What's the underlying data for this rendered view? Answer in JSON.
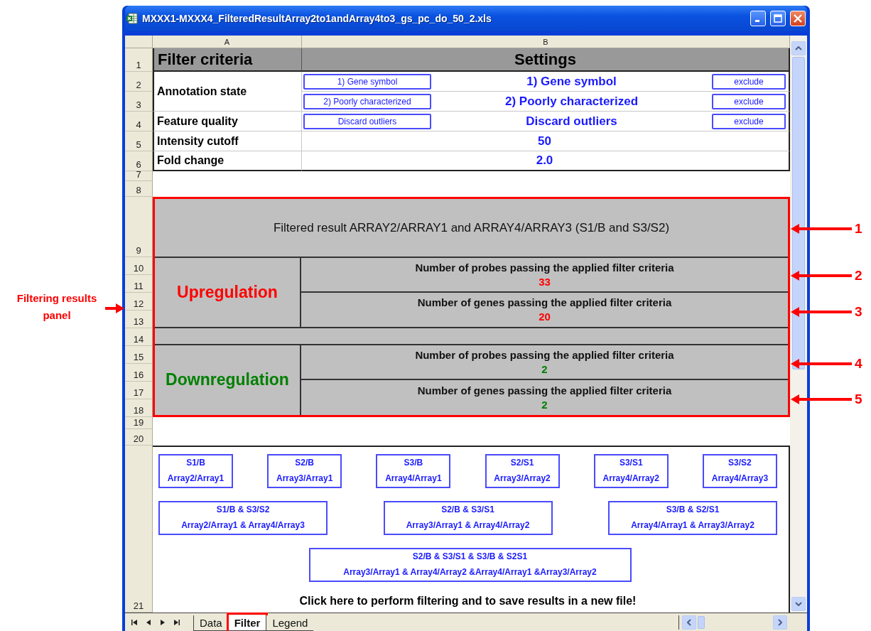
{
  "window": {
    "title": "MXXX1-MXXX4_FilteredResultArray2to1andArray4to3_gs_pc_do_50_2.xls"
  },
  "column_headers": [
    "A",
    "B"
  ],
  "row_numbers": [
    "1",
    "2",
    "3",
    "4",
    "5",
    "6",
    "7",
    "8",
    "9",
    "10",
    "11",
    "12",
    "13",
    "14",
    "15",
    "16",
    "17",
    "18",
    "19",
    "20",
    "21"
  ],
  "criteria": {
    "header": [
      "Filter criteria",
      "Settings"
    ],
    "rows": [
      {
        "label": "Annotation state",
        "settings": [
          {
            "button": "1) Gene symbol",
            "value": "1) Gene symbol",
            "action": "exclude"
          },
          {
            "button": "2) Poorly characterized",
            "value": "2) Poorly characterized",
            "action": "exclude"
          }
        ]
      },
      {
        "label": "Feature quality",
        "settings": [
          {
            "button": "Discard outliers",
            "value": "Discard outliers",
            "action": "exclude"
          }
        ]
      },
      {
        "label": "Intensity cutoff",
        "settings": [
          {
            "value": "50"
          }
        ]
      },
      {
        "label": "Fold change",
        "settings": [
          {
            "value": "2.0"
          }
        ]
      }
    ]
  },
  "results": {
    "title": "Filtered result ARRAY2/ARRAY1 and ARRAY4/ARRAY3 (S1/B and S3/S2)",
    "groups": [
      {
        "label": "Upregulation",
        "color": "#ff0000",
        "metrics": [
          {
            "label": "Number of probes passing the applied filter criteria",
            "value": "33"
          },
          {
            "label": "Number of genes passing the applied filter criteria",
            "value": "20"
          }
        ]
      },
      {
        "label": "Downregulation",
        "color": "#008000",
        "metrics": [
          {
            "label": "Number of probes passing the applied filter criteria",
            "value": "2"
          },
          {
            "label": "Number of genes passing the applied filter criteria",
            "value": "2"
          }
        ]
      }
    ]
  },
  "comparison_buttons": [
    [
      {
        "top": "S1/B",
        "bottom": "Array2/Array1"
      },
      {
        "top": "S2/B",
        "bottom": "Array3/Array1"
      },
      {
        "top": "S3/B",
        "bottom": "Array4/Array1"
      },
      {
        "top": "S2/S1",
        "bottom": "Array3/Array2"
      },
      {
        "top": "S3/S1",
        "bottom": "Array4/Array2"
      },
      {
        "top": "S3/S2",
        "bottom": "Array4/Array3"
      }
    ],
    [
      {
        "top": "S1/B & S3/S2",
        "bottom": "Array2/Array1 & Array4/Array3"
      },
      {
        "top": "S2/B & S3/S1",
        "bottom": "Array3/Array1 & Array4/Array2"
      },
      {
        "top": "S3/B & S2/S1",
        "bottom": "Array4/Array1 & Array3/Array2"
      }
    ],
    [
      {
        "top": "S2/B & S3/S1 & S3/B & S2S1",
        "bottom": "Array3/Array1 & Array4/Array2 &Array4/Array1 &Array3/Array2"
      }
    ]
  ],
  "footer": "Click here to perform filtering and to save results in a new file!",
  "sheet_tabs": [
    {
      "label": "Data",
      "selected": false,
      "highlighted": false
    },
    {
      "label": "Filter",
      "selected": true,
      "highlighted": true
    },
    {
      "label": "Legend",
      "selected": false,
      "highlighted": false
    }
  ],
  "annotations": {
    "panel_label": "Filtering results panel",
    "callouts": [
      "1",
      "2",
      "3",
      "4",
      "5"
    ]
  }
}
